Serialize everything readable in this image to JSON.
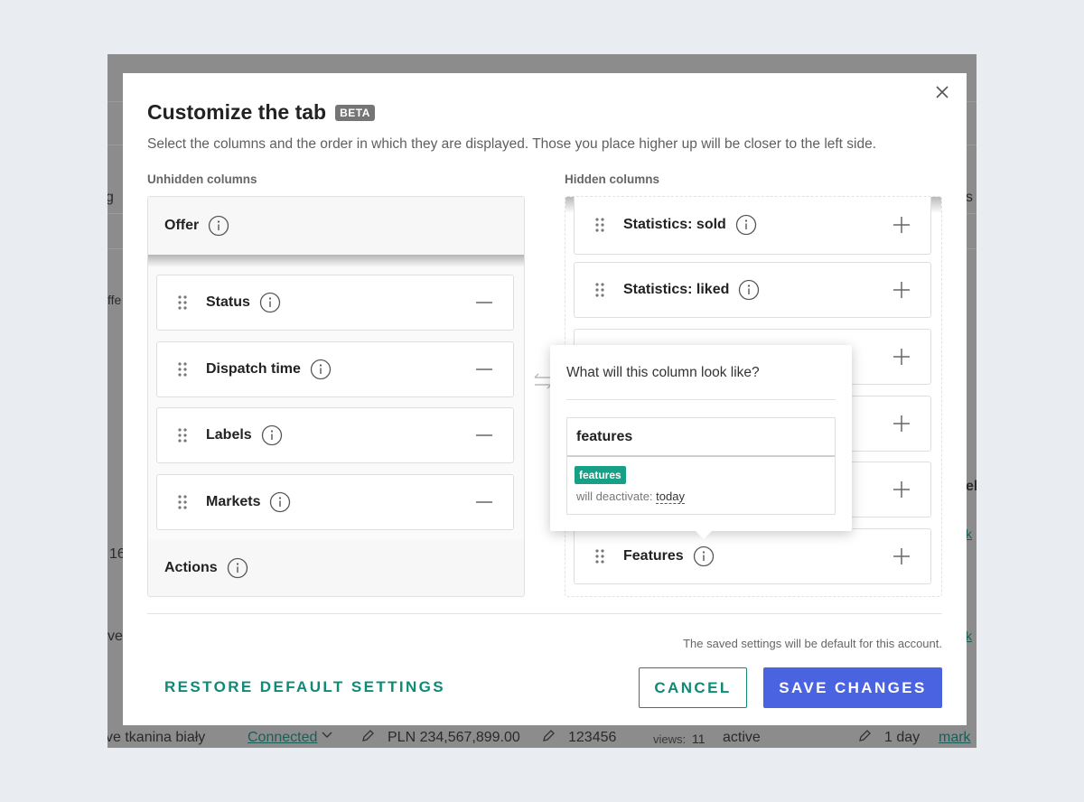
{
  "background": {
    "bottom_row": {
      "product": "ve tkanina biały",
      "status_link": "Connected",
      "price": "PLN 234,567,899.00",
      "id": "123456",
      "views_label": "views:",
      "views_value": "11",
      "state": "active",
      "duration": "1 day",
      "link": "mark"
    },
    "left_fragments": [
      "g",
      "ffe",
      "16",
      "ve"
    ],
    "right_fragments": [
      "s",
      "el",
      "k",
      "k"
    ]
  },
  "modal": {
    "title": "Customize the tab",
    "beta_badge": "BETA",
    "subtitle": "Select the columns and the order in which they are displayed. Those you place higher up will be closer to the left side.",
    "unhidden_heading": "Unhidden columns",
    "hidden_heading": "Hidden columns",
    "unhidden": {
      "fixed_top": "Offer",
      "items": [
        "Status",
        "Dispatch time",
        "Labels",
        "Markets"
      ],
      "fixed_bottom": "Actions"
    },
    "hidden": {
      "items": [
        "Statistics: sold",
        "Statistics: liked",
        "",
        "",
        "",
        "Features"
      ]
    },
    "popover": {
      "title": "What will this column look like?",
      "preview_header": "features",
      "badge": "features",
      "sub_prefix": "will deactivate:",
      "sub_link": "today"
    },
    "footnote": "The saved settings will be default for this account.",
    "restore_label": "RESTORE DEFAULT SETTINGS",
    "cancel_label": "CANCEL",
    "save_label": "SAVE CHANGES"
  },
  "colors": {
    "accent_green": "#0f8a75",
    "badge_green": "#18a086",
    "primary_blue": "#4a63e0",
    "overlay": "#8c8c8c"
  }
}
